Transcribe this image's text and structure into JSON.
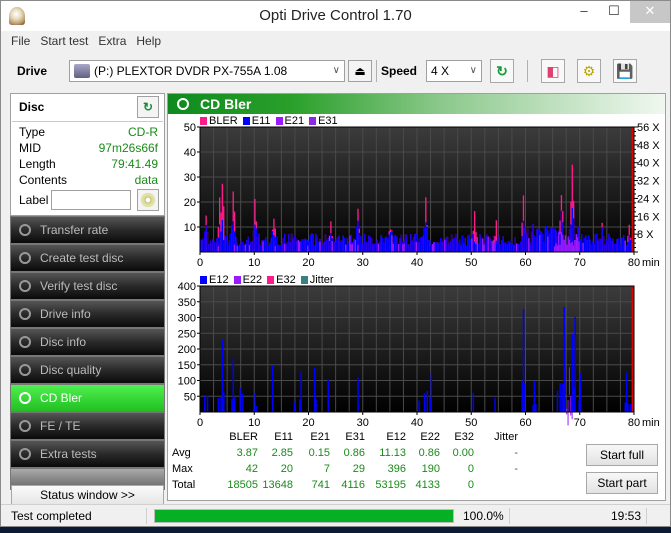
{
  "window": {
    "title": "Opti Drive Control 1.70",
    "controls": {
      "minimize": "–",
      "maximize": "☐",
      "close": "✕"
    }
  },
  "menu": [
    "File",
    "Start test",
    "Extra",
    "Help"
  ],
  "toolbar": {
    "drive_label": "Drive",
    "drive_value": "(P:)  PLEXTOR DVDR   PX-755A 1.08",
    "speed_label": "Speed",
    "speed_value": "4 X",
    "icons": [
      "refresh-icon",
      "eraser-icon",
      "settings-icon",
      "save-icon"
    ]
  },
  "disc": {
    "title": "Disc",
    "fields": [
      {
        "key": "Type",
        "value": "CD-R"
      },
      {
        "key": "MID",
        "value": "97m26s66f"
      },
      {
        "key": "Length",
        "value": "79:41.49"
      },
      {
        "key": "Contents",
        "value": "data"
      }
    ],
    "label_key": "Label",
    "label_value": ""
  },
  "nav": [
    {
      "label": "Transfer rate",
      "active": false
    },
    {
      "label": "Create test disc",
      "active": false
    },
    {
      "label": "Verify test disc",
      "active": false
    },
    {
      "label": "Drive info",
      "active": false
    },
    {
      "label": "Disc info",
      "active": false
    },
    {
      "label": "Disc quality",
      "active": false
    },
    {
      "label": "CD Bler",
      "active": true
    },
    {
      "label": "FE / TE",
      "active": false
    },
    {
      "label": "Extra tests",
      "active": false
    }
  ],
  "status_window_button": "Status window >>",
  "panel_title": "CD Bler",
  "colors": {
    "bler": "#ff1a8c",
    "e11": "#0000ff",
    "e21": "#9a1aff",
    "e31": "#8a2ae6",
    "e12": "#0000ff",
    "e22": "#9a1aff",
    "e32": "#ff1a8c",
    "jitter": "#3a8080",
    "accent_green": "#22c022",
    "progress": "#06b025"
  },
  "chart_data": [
    {
      "type": "bar",
      "title": "BLER / E11 / E21 / E31",
      "legend": [
        "BLER",
        "E11",
        "E21",
        "E31"
      ],
      "legend_position": "top-left",
      "xlabel": "min",
      "x_ticks": [
        0,
        10,
        20,
        30,
        40,
        50,
        60,
        70,
        80
      ],
      "y_ticks": [
        10,
        20,
        30,
        40,
        50
      ],
      "y2_ticks": [
        "8 X",
        "16 X",
        "24 X",
        "32 X",
        "40 X",
        "48 X",
        "56 X"
      ],
      "xlim": [
        0,
        80
      ],
      "ylim": [
        0,
        50
      ],
      "grid": true,
      "end_marker_min": 79.7,
      "peaks_bler": [
        [
          1,
          22
        ],
        [
          3.5,
          25
        ],
        [
          4,
          35
        ],
        [
          6,
          29
        ],
        [
          10,
          22
        ],
        [
          13.5,
          20
        ],
        [
          24,
          14
        ],
        [
          29,
          20
        ],
        [
          35,
          15
        ],
        [
          41.5,
          24
        ],
        [
          50.5,
          17
        ],
        [
          54.5,
          13
        ],
        [
          59.5,
          25
        ],
        [
          66.5,
          32
        ],
        [
          68.5,
          40
        ],
        [
          74,
          12
        ],
        [
          79,
          14
        ]
      ],
      "baseline_e11": 5
    },
    {
      "type": "bar",
      "title": "E12 / E22 / E32 / Jitter",
      "legend": [
        "E12",
        "E22",
        "E32",
        "Jitter"
      ],
      "legend_position": "top-left",
      "xlabel": "min",
      "x_ticks": [
        0,
        10,
        20,
        30,
        40,
        50,
        60,
        70,
        80
      ],
      "y_ticks": [
        50,
        100,
        150,
        200,
        250,
        300,
        350,
        400
      ],
      "xlim": [
        0,
        80
      ],
      "ylim": [
        0,
        400
      ],
      "grid": true,
      "end_marker_min": 79.7,
      "peaks_e12": [
        [
          1,
          248
        ],
        [
          3.5,
          170
        ],
        [
          4,
          232
        ],
        [
          6,
          172
        ],
        [
          7.5,
          270
        ],
        [
          10,
          70
        ],
        [
          13.2,
          235
        ],
        [
          17,
          127
        ],
        [
          18.5,
          152
        ],
        [
          21,
          200
        ],
        [
          23.5,
          115
        ],
        [
          29,
          145
        ],
        [
          40.5,
          153
        ],
        [
          41.5,
          265
        ],
        [
          42.5,
          165
        ],
        [
          50.5,
          268
        ],
        [
          54.5,
          220
        ],
        [
          59.5,
          370
        ],
        [
          61.5,
          110
        ],
        [
          66,
          330
        ],
        [
          67,
          395
        ],
        [
          68.5,
          340
        ],
        [
          69,
          330
        ],
        [
          70,
          150
        ],
        [
          78.5,
          130
        ],
        [
          79.5,
          100
        ]
      ],
      "peaks_e22": [
        [
          68,
          180
        ]
      ]
    }
  ],
  "stats": {
    "columns": [
      "BLER",
      "E11",
      "E21",
      "E31",
      "E12",
      "E22",
      "E32",
      "Jitter"
    ],
    "rows": [
      {
        "label": "Avg",
        "values": [
          "3.87",
          "2.85",
          "0.15",
          "0.86",
          "11.13",
          "0.86",
          "0.00",
          "-"
        ]
      },
      {
        "label": "Max",
        "values": [
          "42",
          "20",
          "7",
          "29",
          "396",
          "190",
          "0",
          "-"
        ]
      },
      {
        "label": "Total",
        "values": [
          "18505",
          "13648",
          "741",
          "4116",
          "53195",
          "4133",
          "0",
          ""
        ]
      }
    ]
  },
  "buttons": {
    "start_full": "Start full",
    "start_part": "Start part"
  },
  "statusbar": {
    "text": "Test completed",
    "progress": 100.0,
    "progress_label": "100.0%",
    "time": "19:53"
  }
}
